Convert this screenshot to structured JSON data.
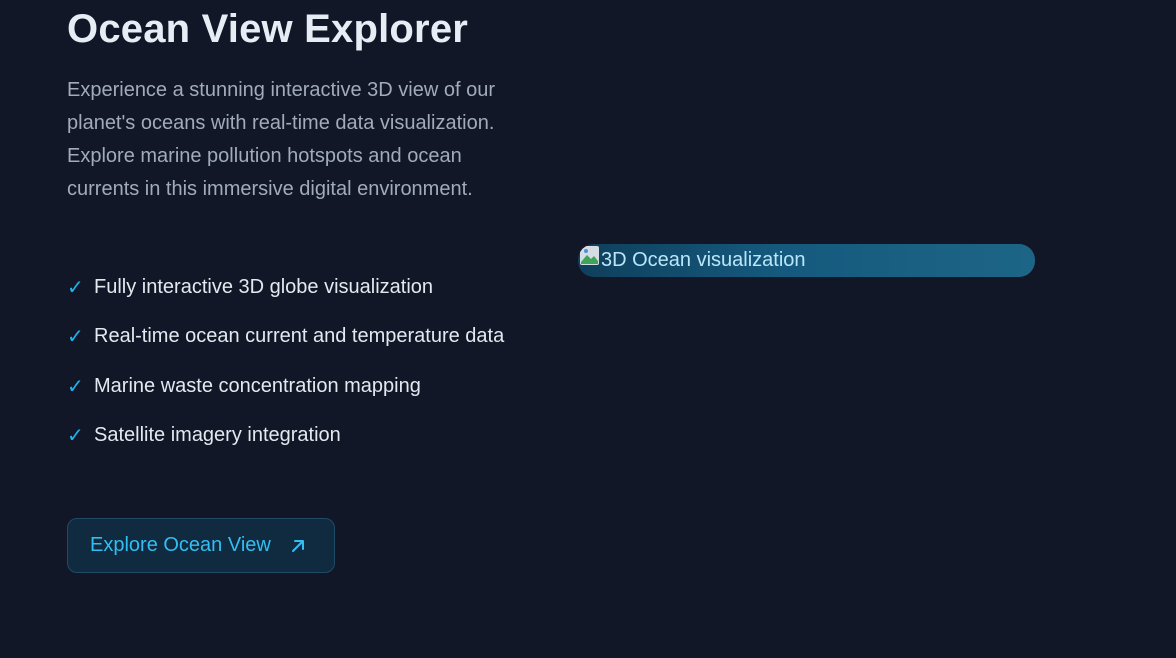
{
  "section": {
    "title": "Ocean View Explorer",
    "description": "Experience a stunning interactive 3D view of our planet's oceans with real-time data visualization. Explore marine pollution hotspots and ocean currents in this immersive digital environment.",
    "features": [
      "Fully interactive 3D globe visualization",
      "Real-time ocean current and temperature data",
      "Marine waste concentration mapping",
      "Satellite imagery integration"
    ],
    "check_glyph": "✓",
    "cta_label": "Explore Ocean View",
    "cta_icon": "arrow-up-right-icon"
  },
  "visual": {
    "alt_text": "3D Ocean visualization",
    "icon": "broken-image-icon"
  },
  "colors": {
    "background": "#111727",
    "accent": "#1fb3f0",
    "heading": "#e8edf5",
    "body_text": "#a1abbb"
  }
}
